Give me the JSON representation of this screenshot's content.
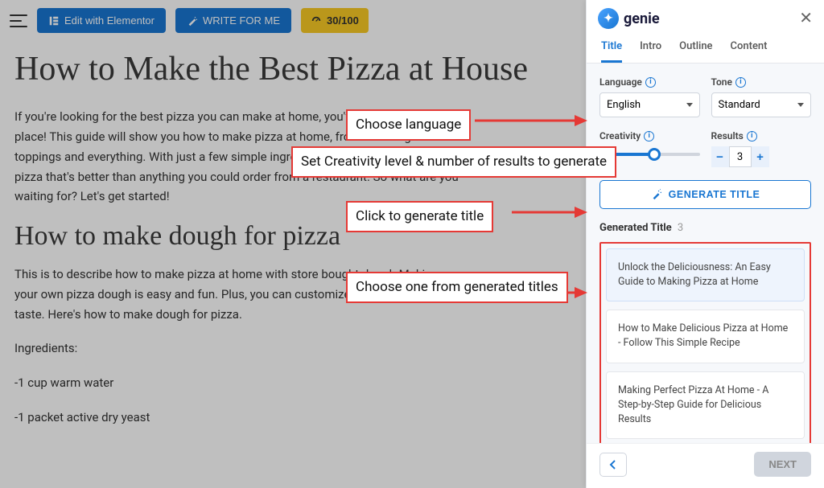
{
  "toolbar": {
    "edit_label": "Edit with Elementor",
    "write_label": "WRITE FOR ME",
    "score_label": "30/100"
  },
  "content": {
    "h1": "How to Make the Best Pizza at House",
    "p1": "If you're looking for the best pizza you can make at home, you've come to the right place! This guide will show you how to make pizza at home, from the dough to the toppings and everything. With just a few simple ingredients, you can have a delicious pizza that's better than anything you could order from a restaurant. So what are you waiting for? Let's get started!",
    "h2": "How to make dough for pizza",
    "p2": "This is to describe how to make pizza at home with store bought dough Making your own pizza dough is easy and fun. Plus, you can customize it to your own taste. Here's how to make dough for pizza.",
    "p3": "Ingredients:",
    "p4": "-1 cup warm water",
    "p5": "-1 packet active dry yeast"
  },
  "sidebar": {
    "brand": "genie",
    "tabs": [
      "Title",
      "Intro",
      "Outline",
      "Content"
    ],
    "language_label": "Language",
    "language_value": "English",
    "tone_label": "Tone",
    "tone_value": "Standard",
    "creativity_label": "Creativity",
    "results_label": "Results",
    "results_value": "3",
    "generate_label": "GENERATE TITLE",
    "generated_title_label": "Generated Title",
    "generated_count": "3",
    "titles": [
      "Unlock the Deliciousness: An Easy Guide to Making Pizza at Home",
      "How to Make Delicious Pizza at Home - Follow This Simple Recipe",
      "Making Perfect Pizza At Home - A Step-by-Step Guide for Delicious Results"
    ],
    "next_label": "NEXT"
  },
  "callouts": {
    "c1": "Choose language",
    "c2": "Set Creativity level & number of results to generate",
    "c3": "Click to generate title",
    "c4": "Choose one from generated titles"
  }
}
